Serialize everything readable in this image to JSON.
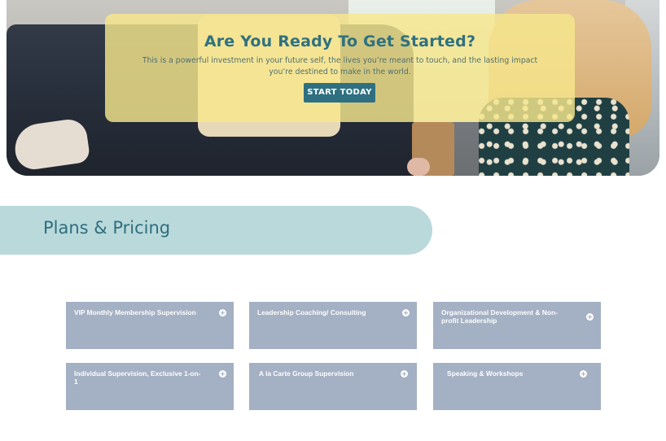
{
  "hero": {
    "heading": "Are You Ready To Get Started?",
    "body": "This is a powerful investment in your future self, the lives you’re meant to touch, and the lasting impact you’re destined to make in the world.",
    "button_label": "START TODAY"
  },
  "plans": {
    "heading": "Plans & Pricing",
    "cards": [
      {
        "label": "VIP Monthly Membership Supervision",
        "icon": "plus-circle-icon"
      },
      {
        "label": "Leadership Coaching/ Consulting",
        "icon": "plus-circle-icon"
      },
      {
        "label": "Organizational Development & Non-profit Leadership",
        "icon": "plus-circle-icon"
      },
      {
        "label": "Individual Supervision, Exclusive 1-on-1",
        "icon": "plus-circle-icon"
      },
      {
        "label": "A la Carte Group Supervision",
        "icon": "plus-circle-icon"
      },
      {
        "label": "Speaking & Workshops",
        "icon": "plus-circle-icon"
      }
    ]
  },
  "colors": {
    "accent": "#2e7081",
    "cta_overlay": "#f6e78c",
    "banner": "#b9d9db",
    "card": "#a4b0c3"
  }
}
